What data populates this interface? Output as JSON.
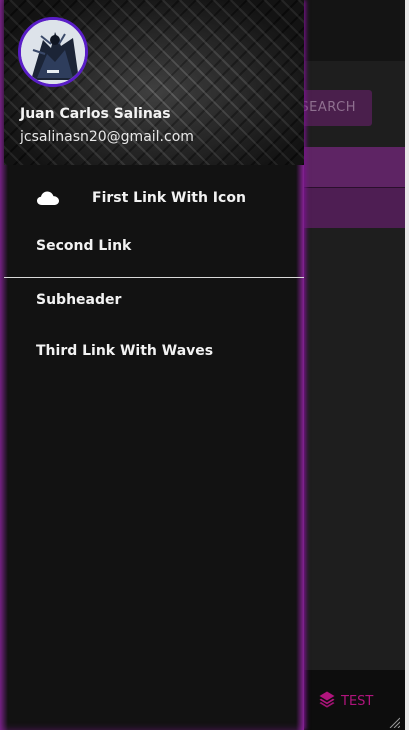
{
  "background": {
    "search_button_label": "Search",
    "test_button_label": "TEST",
    "test_icon": "layers-icon",
    "colors": {
      "accent_band": "#5e2464",
      "test_accent": "#b0147d"
    }
  },
  "drawer": {
    "user": {
      "name": "Juan Carlos Salinas",
      "email": "jcsalinasn20@gmail.com"
    },
    "items": [
      {
        "label": "First Link With Icon",
        "icon": "cloud-icon"
      },
      {
        "label": "Second Link"
      }
    ],
    "subheader": "Subheader",
    "waves_item": {
      "label": "Third Link With Waves"
    }
  }
}
